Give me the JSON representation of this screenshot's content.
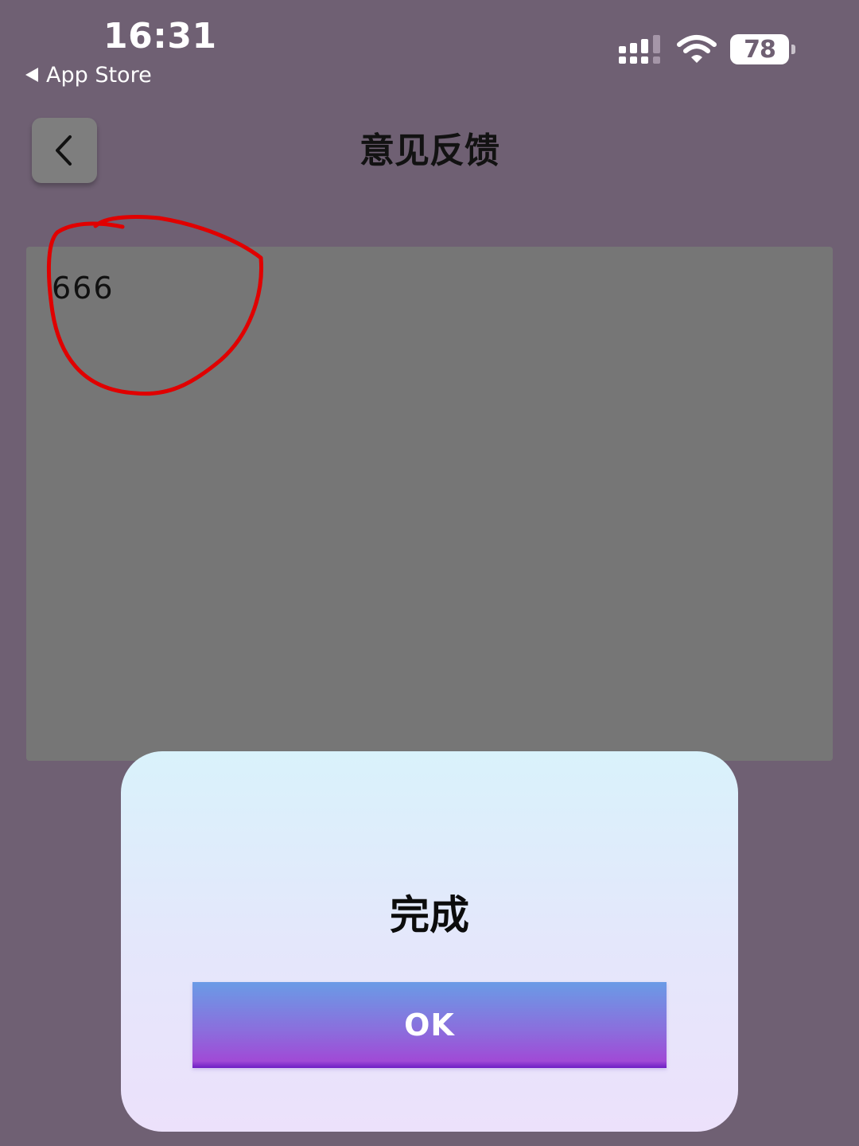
{
  "status_bar": {
    "time": "16:31",
    "back_app_label": "App Store",
    "battery_level": "78",
    "icons": [
      "signal-icon",
      "wifi-icon",
      "battery-icon"
    ]
  },
  "nav": {
    "title": "意见反馈",
    "back_icon": "chevron-left-icon"
  },
  "feedback": {
    "text": "666"
  },
  "annotation": {
    "color": "#e00000"
  },
  "dialog": {
    "message": "完成",
    "ok_label": "OK"
  },
  "colors": {
    "background": "#6f6073",
    "input_background": "#767676",
    "button_gradient_top": "#6a9be6",
    "button_gradient_bottom": "#a04ad6"
  }
}
